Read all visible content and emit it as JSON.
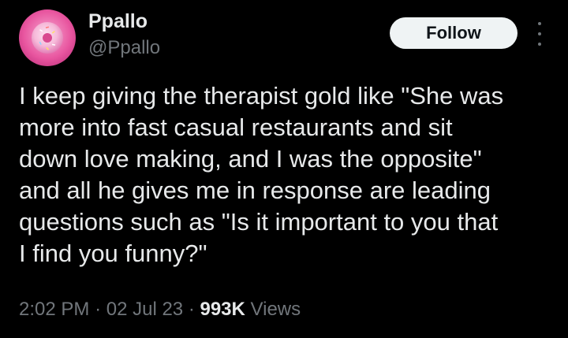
{
  "colors": {
    "background": "#000000",
    "primary_text": "#e7e9ea",
    "secondary_text": "#71767b",
    "follow_button_bg": "#eff3f4",
    "follow_button_text": "#0f1419",
    "avatar_primary": "#e8559f"
  },
  "author": {
    "display_name": "Ppallo",
    "handle": "@Ppallo",
    "avatar_icon": "donut-icon"
  },
  "actions": {
    "follow_label": "Follow",
    "more_icon": "more-vertical-icon"
  },
  "tweet": {
    "text": "I keep giving the therapist gold like \"She was\nmore into fast casual restaurants and sit\ndown love making, and I was the opposite\"\nand all he gives me in response are leading\nquestions such as \"Is it important to you that\nI find you funny?\""
  },
  "meta": {
    "time": "2:02 PM",
    "separator": "·",
    "date": "02 Jul 23",
    "views_count": "993K",
    "views_label": "Views"
  }
}
